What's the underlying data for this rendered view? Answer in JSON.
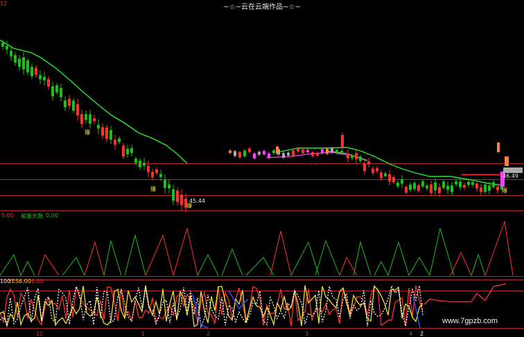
{
  "title": "~☆~云在云端作品~☆~",
  "top_left_mark": "12",
  "panels": {
    "main": {
      "price_low_label": "45.44",
      "marker_char": "爆",
      "right_price_label": "46.49"
    },
    "vol": {
      "label_a": "5.00",
      "label_b": "缩量天数",
      "label_c": "0.00"
    },
    "osc": {
      "label_a": "100",
      "label_b": "YES",
      "label_c": "6.00",
      "label_d": "6.00"
    }
  },
  "x_axis": {
    "ticks": [
      "12",
      "1",
      "2",
      "3",
      "4"
    ],
    "last_tick": "2"
  },
  "watermark": "www.7gpzb.com",
  "colors": {
    "up": "#ff3030",
    "down": "#18c018",
    "ma": "#2ee82e",
    "magenta": "#ff40ff",
    "yellow": "#f0e040",
    "white": "#e8e8e8",
    "blue": "#3050ff",
    "grid": "#b0282a"
  },
  "chart_data": {
    "type": "candlestick",
    "title": "~☆~云在云端作品~☆~",
    "price_labels": [
      "45.44",
      "46.49"
    ],
    "indicator_labels": [
      "5.00",
      "缩量天数",
      "0.00",
      "100",
      "YES",
      "6.00",
      "6.00"
    ],
    "x_ticks": [
      "12",
      "1",
      "2",
      "3",
      "4",
      "2"
    ]
  }
}
